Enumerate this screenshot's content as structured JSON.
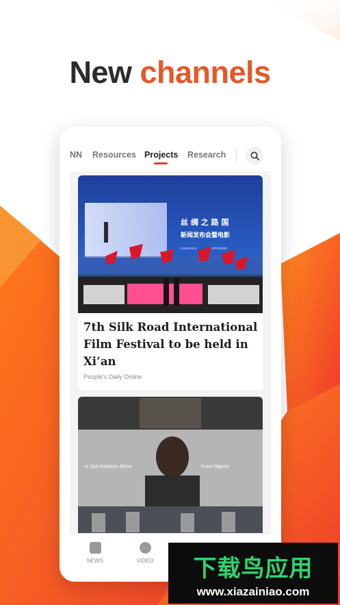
{
  "headline": {
    "word1": "New",
    "word2": "channels"
  },
  "tabs": [
    {
      "label": "NN",
      "active": false
    },
    {
      "label": "Resources",
      "active": false
    },
    {
      "label": "Projects",
      "active": true
    },
    {
      "label": "Research",
      "active": false
    }
  ],
  "search": {
    "icon": "search-icon"
  },
  "feed": [
    {
      "title": "7th Silk Road International Film Festival to be held in Xi’an",
      "source": "People's Daily Online",
      "image_text": {
        "line1": "丝 绸 之 路 国",
        "line2": "新闻发布会暨电影",
        "badge1": "GUIDANCE",
        "badge2": "SPONSOR"
      }
    },
    {
      "image_text": {
        "left": "in Sub-Saharan Africa",
        "right": "From Nigeria"
      }
    }
  ],
  "bottom_nav": [
    {
      "label": "NEWS",
      "icon": "news-icon"
    },
    {
      "label": "VIDEO",
      "icon": "video-icon"
    }
  ],
  "watermark": {
    "title": "下载鸟应用",
    "url": "www.xiazainiao.com"
  },
  "colors": {
    "accent": "#e5592a",
    "tab_underline": "#e03a2f",
    "watermark_green": "#2fd36e"
  }
}
